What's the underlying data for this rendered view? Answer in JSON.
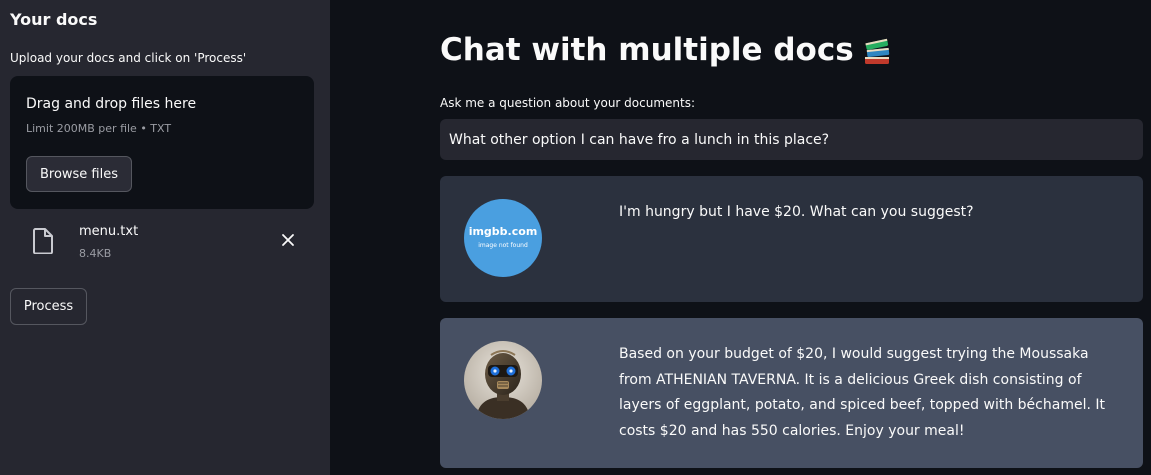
{
  "sidebar": {
    "title": "Your docs",
    "upload_label": "Upload your docs and click on 'Process'",
    "dropzone": {
      "title": "Drag and drop files here",
      "limit": "Limit 200MB per file • TXT",
      "browse_label": "Browse files"
    },
    "file": {
      "name": "menu.txt",
      "size": "8.4KB",
      "icon": "file-icon",
      "remove_icon": "close-icon"
    },
    "process_label": "Process"
  },
  "main": {
    "title": "Chat with multiple docs",
    "title_icon": "books-emoji",
    "question_label": "Ask me a question about your documents:",
    "question_value": "What other option I can have fro a lunch in this place?"
  },
  "chat": {
    "messages": [
      {
        "role": "user",
        "avatar_text": "imgbb.com",
        "avatar_subtext": "image not found",
        "text": "I'm hungry but I have $20. What can you suggest?"
      },
      {
        "role": "bot",
        "avatar": "robot-avatar",
        "text": "Based on your budget of $20, I would suggest trying the Moussaka from ATHENIAN TAVERNA. It is a delicious Greek dish consisting of layers of eggplant, potato, and spiced beef, topped with béchamel. It costs $20 and has 550 calories. Enjoy your meal!"
      }
    ]
  },
  "colors": {
    "app_background": "#0e1117",
    "sidebar_background": "#262730",
    "user_message_background": "#2b313e",
    "bot_message_background": "#475063",
    "text": "#fafafa",
    "muted_text": "#9a9ca3",
    "avatar_placeholder": "#4a9fe0"
  }
}
